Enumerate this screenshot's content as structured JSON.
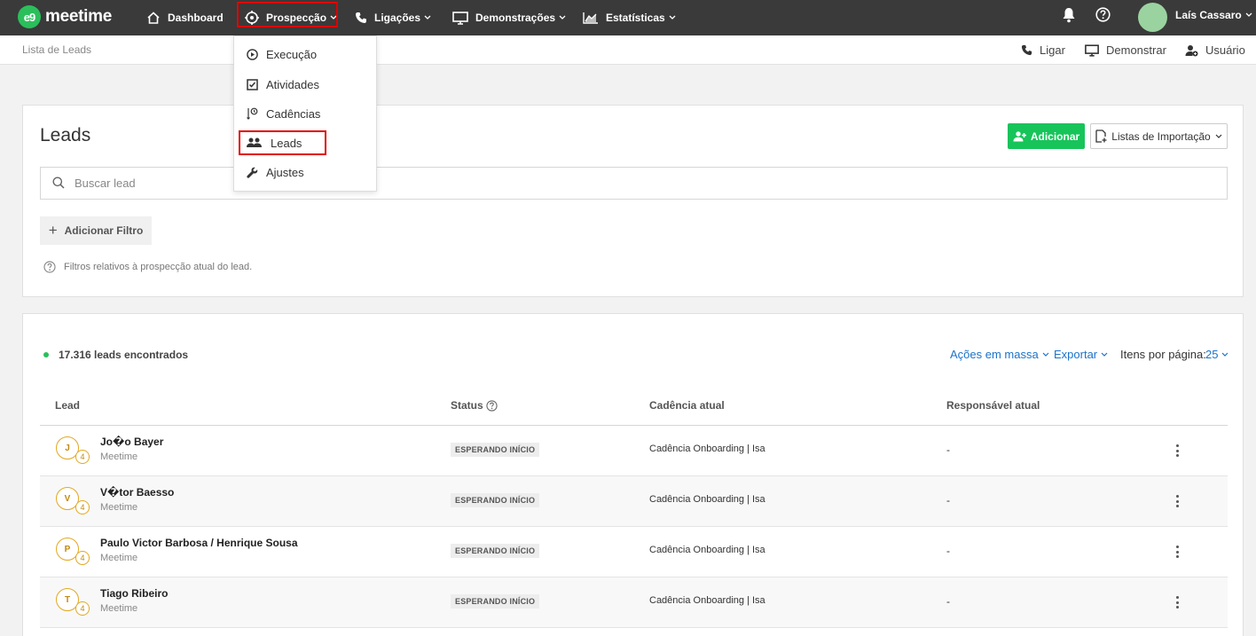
{
  "brand": {
    "logo_mark": "e9",
    "logo_text": "meetime",
    "accent": "#17c45a"
  },
  "topnav": {
    "items": [
      {
        "label": "Dashboard",
        "icon": "home-icon"
      },
      {
        "label": "Prospecção",
        "icon": "target-icon",
        "active": true
      },
      {
        "label": "Ligações",
        "icon": "phone-icon"
      },
      {
        "label": "Demonstrações",
        "icon": "monitor-icon"
      },
      {
        "label": "Estatísticas",
        "icon": "chart-icon"
      }
    ],
    "user_name": "Laís Cassaro"
  },
  "subbar": {
    "breadcrumb": "Lista de Leads",
    "actions": [
      {
        "label": "Ligar",
        "icon": "phone-icon"
      },
      {
        "label": "Demonstrar",
        "icon": "monitor-icon"
      },
      {
        "label": "Usuário",
        "icon": "user-add-icon"
      }
    ]
  },
  "prospeccao_menu": {
    "items": [
      {
        "label": "Execução",
        "icon": "play-icon"
      },
      {
        "label": "Atividades",
        "icon": "checkbox-icon"
      },
      {
        "label": "Cadências",
        "icon": "cadence-icon"
      },
      {
        "label": "Leads",
        "icon": "users-icon",
        "active": true
      },
      {
        "label": "Ajustes",
        "icon": "wrench-icon"
      }
    ]
  },
  "filters": {
    "title": "Leads",
    "add_button": "Adicionar",
    "import_button": "Listas de Importação",
    "search_placeholder": "Buscar lead",
    "add_filter": "Adicionar Filtro",
    "hint": "Filtros relativos à prospecção atual do lead."
  },
  "results": {
    "count_text": "17.316 leads encontrados",
    "bulk_actions": "Ações em massa",
    "export": "Exportar",
    "per_page_label": "Itens por página:",
    "per_page_value": "25",
    "columns": [
      "Lead",
      "Status",
      "Cadência atual",
      "Responsável atual"
    ],
    "rows": [
      {
        "initial": "J",
        "badge": "4",
        "name": "Jo�o Bayer",
        "company": "Meetime",
        "status": "ESPERANDO INÍCIO",
        "cadence": "Cadência Onboarding | Isa",
        "owner": "-"
      },
      {
        "initial": "V",
        "badge": "4",
        "name": "V�tor Baesso",
        "company": "Meetime",
        "status": "ESPERANDO INÍCIO",
        "cadence": "Cadência Onboarding | Isa",
        "owner": "-"
      },
      {
        "initial": "P",
        "badge": "4",
        "name": "Paulo Victor Barbosa / Henrique Sousa",
        "company": "Meetime",
        "status": "ESPERANDO INÍCIO",
        "cadence": "Cadência Onboarding | Isa",
        "owner": "-"
      },
      {
        "initial": "T",
        "badge": "4",
        "name": "Tiago Ribeiro",
        "company": "Meetime",
        "status": "ESPERANDO INÍCIO",
        "cadence": "Cadência Onboarding | Isa",
        "owner": "-"
      }
    ]
  }
}
